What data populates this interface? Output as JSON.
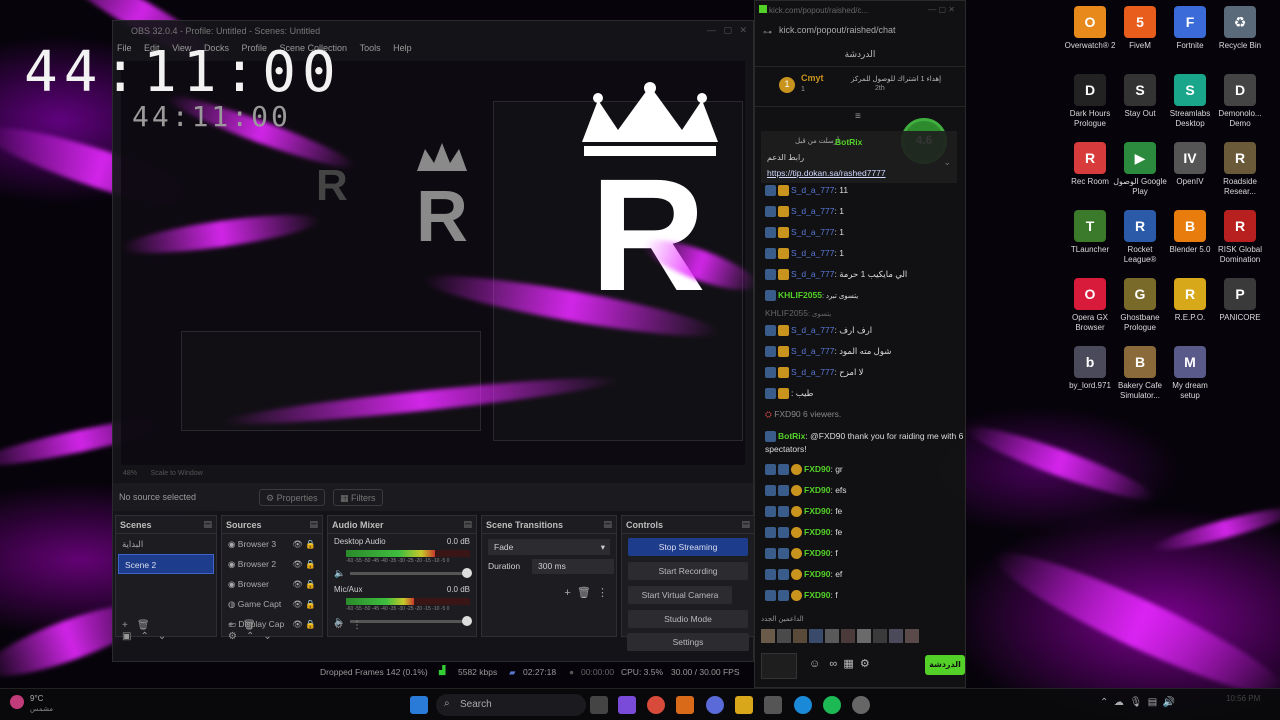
{
  "clock": {
    "big": "44:11:00",
    "small": "44:11:00"
  },
  "obs": {
    "title": "OBS 32.0.4 - Profile: Untitled - Scenes: Untitled",
    "menu": [
      "File",
      "Edit",
      "View",
      "Docks",
      "Profile",
      "Scene Collection",
      "Tools",
      "Help"
    ],
    "zoom": "48%",
    "scale_label": "Scale to Window",
    "no_source": "No source selected",
    "properties": "Properties",
    "filters": "Filters",
    "docks": {
      "scenes": {
        "title": "Scenes",
        "items": [
          "البداية",
          "Scene 2"
        ]
      },
      "sources": {
        "title": "Sources",
        "items": [
          "Browser 3",
          "Browser 2",
          "Browser",
          "Game Capt",
          "Display Cap"
        ]
      },
      "mixer": {
        "title": "Audio Mixer",
        "channels": [
          {
            "name": "Desktop Audio",
            "db": "0.0 dB",
            "level": 0.72
          },
          {
            "name": "Mic/Aux",
            "db": "0.0 dB",
            "level": 0.55
          }
        ],
        "scale": "-60 -55 -50 -45 -40 -35 -30 -25 -20 -15 -10 -5 0"
      },
      "transitions": {
        "title": "Scene Transitions",
        "type": "Fade",
        "duration_label": "Duration",
        "duration": "300 ms"
      },
      "controls": {
        "title": "Controls",
        "buttons": [
          "Stop Streaming",
          "Start Recording",
          "Start Virtual Camera",
          "Studio Mode",
          "Settings"
        ]
      }
    },
    "status": {
      "dropped": "Dropped Frames 142 (0.1%)",
      "bitrate": "5582 kbps",
      "stream_time": "02:27:18",
      "rec_time": "00:00:00",
      "cpu": "CPU: 3.5%",
      "fps": "30.00 / 30.00 FPS"
    }
  },
  "chat": {
    "tab": "kick.com/popout/raished/c...",
    "url": "kick.com/popout/raished/chat",
    "header": "الدردشة",
    "pinned_user": "Cmyt",
    "pinned_count": "1",
    "pinned_text": "إهداء 1 اشتراك للوصول للمركز",
    "pinned_rank": "2th",
    "rating": "4.6",
    "bot_title": "BotRix",
    "bot_pinned_label": "أرسلت من قبل",
    "bot_link_label": "رابط الدعم",
    "bot_link": "https://tip.dokan.sa/rashed7777",
    "messages": [
      {
        "user": "S_d_a_777",
        "text": ": 11",
        "color": "blue"
      },
      {
        "user": "S_d_a_777",
        "text": ": 1",
        "color": "blue"
      },
      {
        "user": "S_d_a_777",
        "text": ": 1",
        "color": "blue"
      },
      {
        "user": "S_d_a_777",
        "text": ": 1",
        "color": "blue"
      },
      {
        "user": "S_d_a_777",
        "text": ": الي مايكيب 1 حرمة",
        "color": "blue"
      },
      {
        "user": "KHLIF2055",
        "text": ": يتسوى تبرد",
        "color": "green"
      },
      {
        "user": "KHLIF2055",
        "text": ": يتسوى",
        "color": "dim"
      },
      {
        "user": "S_d_a_777",
        "text": ": ارف ارف",
        "color": "blue"
      },
      {
        "user": "S_d_a_777",
        "text": ": شول مته المود",
        "color": "blue"
      },
      {
        "user": "S_d_a_777",
        "text": ": لا امزح",
        "color": "blue"
      },
      {
        "user": "",
        "text": ": طيب",
        "color": "dim"
      }
    ],
    "raid_text": "FXD90 6 viewers.",
    "bot_raid": "@FXD90 thank you for raiding me with 6 spectators!",
    "fxd_messages": [
      {
        "user": "FXD90",
        "text": ": gr"
      },
      {
        "user": "FXD90",
        "text": ": efs"
      },
      {
        "user": "FXD90",
        "text": ": fe"
      },
      {
        "user": "FXD90",
        "text": ": fe"
      },
      {
        "user": "FXD90",
        "text": ": f"
      },
      {
        "user": "FXD90",
        "text": ": ef"
      },
      {
        "user": "FXD90",
        "text": ": f"
      }
    ],
    "supporters_label": "الداعمين الجدد",
    "send_button": "الدردشة"
  },
  "desktop_icons": [
    {
      "label": "Overwatch® 2",
      "color": "#e8891c",
      "glyph": "O"
    },
    {
      "label": "FiveM",
      "color": "#e85d1c",
      "glyph": "5"
    },
    {
      "label": "Fortnite",
      "color": "#3a6bd8",
      "glyph": "F"
    },
    {
      "label": "Recycle Bin",
      "color": "#5a6a7a",
      "glyph": "♻"
    },
    {
      "label": "Dark Hours Prologue",
      "color": "#222",
      "glyph": "D"
    },
    {
      "label": "Stay Out",
      "color": "#333",
      "glyph": "S"
    },
    {
      "label": "Streamlabs Desktop",
      "color": "#19a68a",
      "glyph": "S"
    },
    {
      "label": "Demonolo... Demo",
      "color": "#444",
      "glyph": "D"
    },
    {
      "label": "Rec Room",
      "color": "#d83b3b",
      "glyph": "R"
    },
    {
      "label": "الوصول Google Play",
      "color": "#2b8a3e",
      "glyph": "▶"
    },
    {
      "label": "OpenIV",
      "color": "#555",
      "glyph": "IV"
    },
    {
      "label": "Roadside Resear...",
      "color": "#6a5a3a",
      "glyph": "R"
    },
    {
      "label": "TLauncher",
      "color": "#3a7a2a",
      "glyph": "T"
    },
    {
      "label": "Rocket League®",
      "color": "#2a5aa8",
      "glyph": "R"
    },
    {
      "label": "Blender 5.0",
      "color": "#e87d0d",
      "glyph": "B"
    },
    {
      "label": "RISK Global Domination",
      "color": "#b82020",
      "glyph": "R"
    },
    {
      "label": "Opera GX Browser",
      "color": "#d81b3a",
      "glyph": "O"
    },
    {
      "label": "Ghostbane Prologue",
      "color": "#7a6a2a",
      "glyph": "G"
    },
    {
      "label": "R.E.P.O.",
      "color": "#d8a81b",
      "glyph": "R"
    },
    {
      "label": "PANICORE",
      "color": "#3a3a3a",
      "glyph": "P"
    },
    {
      "label": "by_lord.971",
      "color": "#4a4a5a",
      "glyph": "b"
    },
    {
      "label": "Bakery Cafe Simulator...",
      "color": "#8a6a3a",
      "glyph": "B"
    },
    {
      "label": "My dream setup",
      "color": "#5a5a8a",
      "glyph": "M"
    }
  ],
  "taskbar": {
    "search": "Search",
    "weather": "9°C",
    "weather_sub": "مشمس",
    "time": "10:56 PM"
  }
}
